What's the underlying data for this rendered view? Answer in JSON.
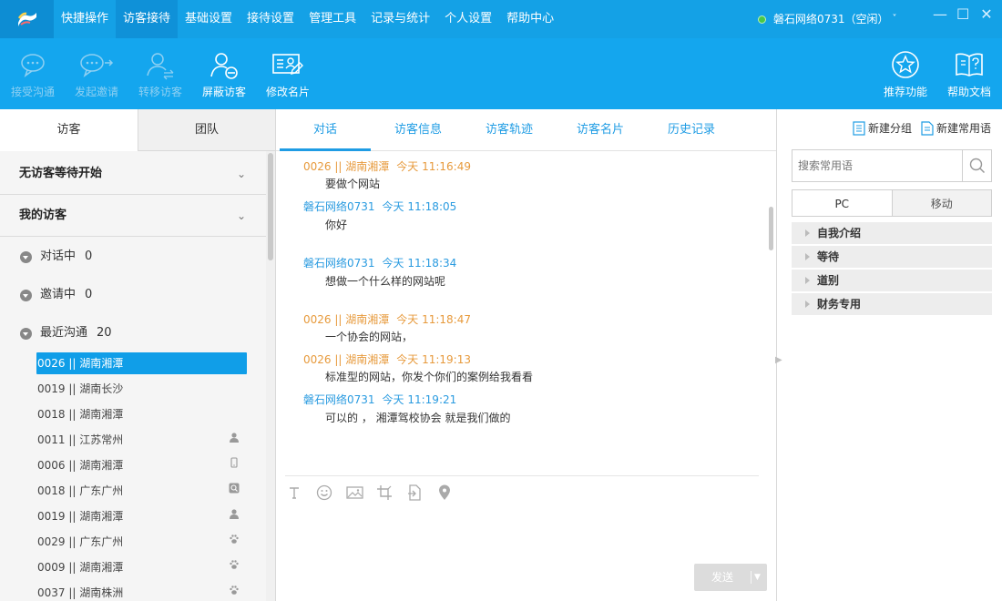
{
  "menu": {
    "items": [
      "快捷操作",
      "访客接待",
      "基础设置",
      "接待设置",
      "管理工具",
      "记录与统计",
      "个人设置",
      "帮助中心"
    ],
    "active_index": 1
  },
  "status": {
    "text": "磐石网络0731（空闲）",
    "chevron": "˅"
  },
  "window_controls": [
    "—",
    "☐",
    "✕"
  ],
  "toolbar": {
    "accept": "接受沟通",
    "invite": "发起邀请",
    "transfer": "转移访客",
    "block": "屏蔽访客",
    "card": "修改名片",
    "recommend": "推荐功能",
    "help_doc": "帮助文档"
  },
  "left": {
    "tabs": [
      "访客",
      "团队"
    ],
    "section_waiting": "无访客等待开始",
    "section_mine": "我的访客",
    "groups": [
      {
        "label": "对话中",
        "count": "0"
      },
      {
        "label": "邀请中",
        "count": "0"
      },
      {
        "label": "最近沟通",
        "count": "20"
      }
    ],
    "visitors": [
      {
        "label": "0026 || 湖南湘潭",
        "icon": ""
      },
      {
        "label": "0019 || 湖南长沙",
        "icon": ""
      },
      {
        "label": "0018 || 湖南湘潭",
        "icon": ""
      },
      {
        "label": "0011 || 江苏常州",
        "icon": "person-icon"
      },
      {
        "label": "0006 || 湖南湘潭",
        "icon": "phone-icon"
      },
      {
        "label": "0018 || 广东广州",
        "icon": "search-engine-icon"
      },
      {
        "label": "0019 || 湖南湘潭",
        "icon": "person-icon"
      },
      {
        "label": "0029 || 广东广州",
        "icon": "paw-icon"
      },
      {
        "label": "0009 || 湖南湘潭",
        "icon": "paw-icon"
      },
      {
        "label": "0037 || 湖南株洲",
        "icon": "paw-icon"
      }
    ]
  },
  "center": {
    "tabs": [
      "对话",
      "访客信息",
      "访客轨迹",
      "访客名片",
      "历史记录"
    ],
    "messages": [
      {
        "sender": "0026 || 湖南湘潭",
        "time": "今天 11:16:49",
        "text": "要做个网站",
        "from": "visitor"
      },
      {
        "sender": "磐石网络0731",
        "time": "今天 11:18:05",
        "text": "你好",
        "from": "agent"
      },
      {
        "sender": "磐石网络0731",
        "time": "今天 11:18:34",
        "text": "想做一个什么样的网站呢",
        "from": "agent"
      },
      {
        "sender": "0026 || 湖南湘潭",
        "time": "今天 11:18:47",
        "text": "一个协会的网站，",
        "from": "visitor"
      },
      {
        "sender": "0026 || 湖南湘潭",
        "time": "今天 11:19:13",
        "text": "标准型的网站，你发个你们的案例给我看看",
        "from": "visitor"
      },
      {
        "sender": "磐石网络0731",
        "time": "今天 11:19:21",
        "text": "可以的 ， 湘潭驾校协会 就是我们做的",
        "from": "agent"
      }
    ],
    "send_label": "发送",
    "send_arrow": "▼"
  },
  "right": {
    "new_group": "新建分组",
    "new_phrase": "新建常用语",
    "search_placeholder": "搜索常用语",
    "tabs": [
      "PC",
      "移动"
    ],
    "phrase_groups": [
      "自我介绍",
      "等待",
      "道别",
      "财务专用"
    ]
  },
  "colors": {
    "brand_blue": "#14a1e6",
    "toolbar_blue": "#14a6ee",
    "visitor_orange": "#e79a3c",
    "agent_blue": "#2a9be0",
    "selected_blue": "#109ee8"
  }
}
